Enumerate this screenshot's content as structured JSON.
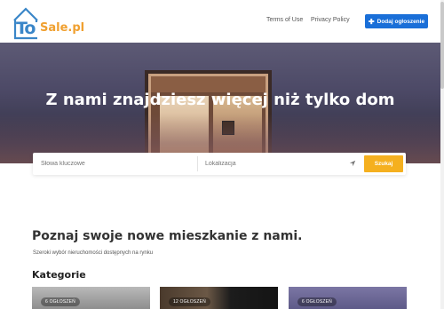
{
  "header": {
    "logo": {
      "part1": "To",
      "part2": "Sale.pl"
    },
    "nav": {
      "terms": "Terms of Use",
      "privacy": "Privacy Policy"
    },
    "add_button": {
      "icon": "plus-icon",
      "label": "Dodaj ogłoszenie"
    }
  },
  "hero": {
    "title": "Z nami znajdziesz więcej niż tylko dom"
  },
  "search": {
    "keywords_placeholder": "Słowa kluczowe",
    "location_placeholder": "Lokalizacja",
    "location_icon": "location-arrow-icon",
    "button_label": "Szukaj"
  },
  "main": {
    "title": "Poznaj swoje nowe mieszkanie z nami.",
    "subtitle": "Szeroki wybór nieruchomości dostępnych na rynku",
    "categories_title": "Kategorie",
    "categories": [
      {
        "badge": "6 OGŁOSZEŃ"
      },
      {
        "badge": "12 OGŁOSZEŃ"
      },
      {
        "badge": "6 OGŁOSZEŃ"
      }
    ]
  },
  "colors": {
    "brand_blue": "#1a6fd8",
    "logo_blue": "#3a86c8",
    "logo_orange": "#f0a030",
    "search_button": "#f5b01f"
  }
}
